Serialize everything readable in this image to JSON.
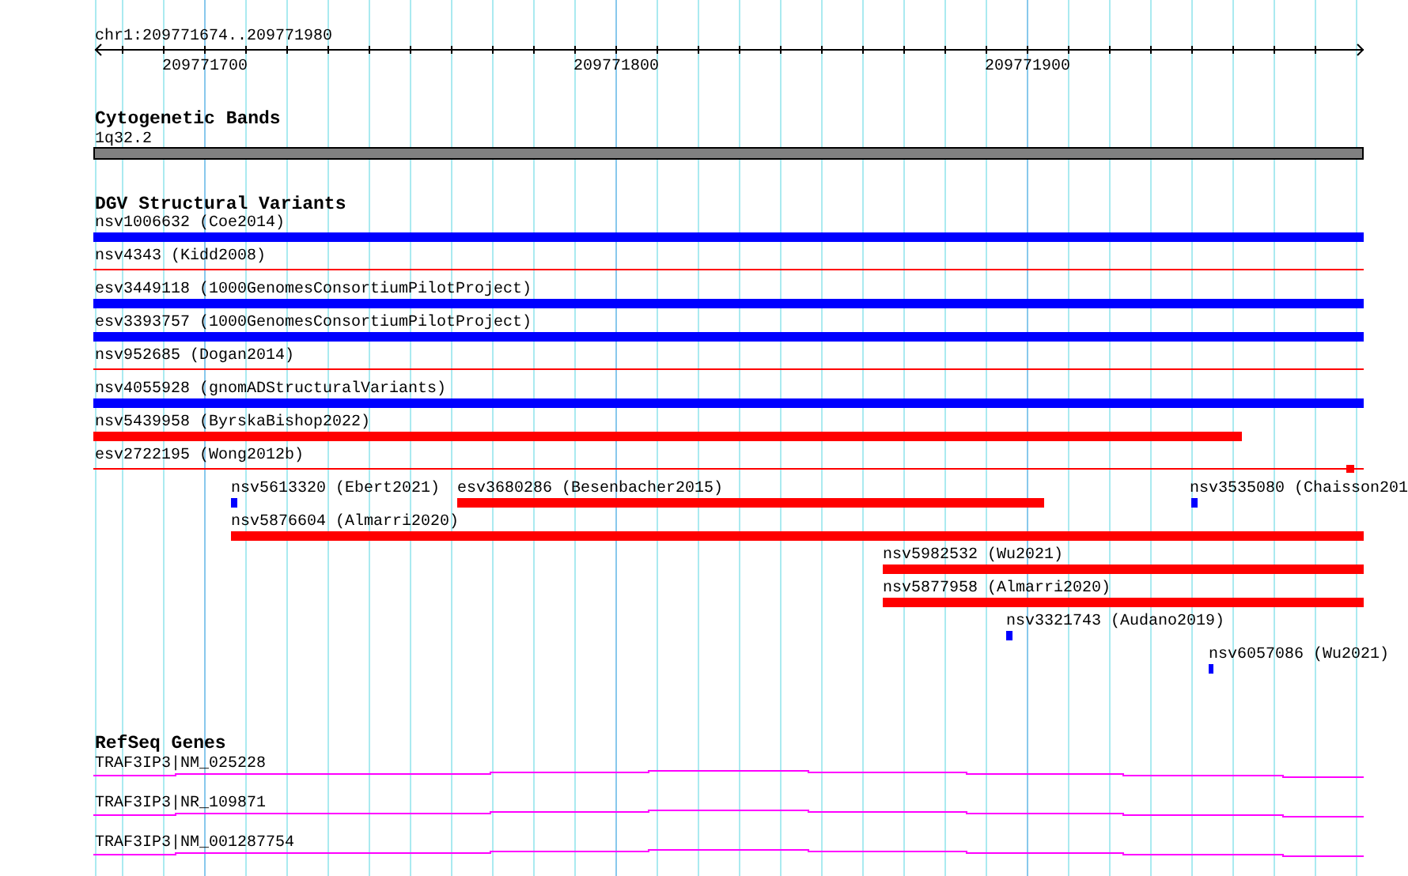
{
  "ruler": {
    "location": "chr1:209771674..209771980",
    "ticks": [
      "209771700",
      "209771800",
      "209771900"
    ]
  },
  "tracks": [
    {
      "kind": "bands",
      "title": "Cytogenetic Bands",
      "features": [
        {
          "label": "1q32.2"
        }
      ]
    },
    {
      "kind": "variants",
      "title": "DGV Structural Variants",
      "features": [
        {
          "label": "nsv1006632 (Coe2014)",
          "kind": "bar",
          "color": "#0000ff"
        },
        {
          "label": "nsv4343 (Kidd2008)",
          "kind": "line",
          "color": "#ff0000"
        },
        {
          "label": "esv3449118 (1000GenomesConsortiumPilotProject)",
          "kind": "bar",
          "color": "#0000ff"
        },
        {
          "label": "esv3393757 (1000GenomesConsortiumPilotProject)",
          "kind": "bar",
          "color": "#0000ff"
        },
        {
          "label": "nsv952685 (Dogan2014)",
          "kind": "line",
          "color": "#ff0000"
        },
        {
          "label": "nsv4055928 (gnomADStructuralVariants)",
          "kind": "bar",
          "color": "#0000ff"
        },
        {
          "label": "nsv5439958 (ByrskaBishop2022)",
          "kind": "bar",
          "color": "#ff0000"
        },
        {
          "label": "esv2722195 (Wong2012b)",
          "kind": "line-end",
          "color": "#ff0000"
        },
        {
          "label": "nsv5613320 (Ebert2021)",
          "kind": "bar",
          "color": "#0000ff"
        },
        {
          "label": "esv3680286 (Besenbacher2015)",
          "kind": "bar",
          "color": "#ff0000"
        },
        {
          "label": "nsv3535080 (Chaisson201",
          "kind": "bar",
          "color": "#0000ff"
        },
        {
          "label": "nsv5876604 (Almarri2020)",
          "kind": "bar",
          "color": "#ff0000"
        },
        {
          "label": "nsv5982532 (Wu2021)",
          "kind": "bar",
          "color": "#ff0000"
        },
        {
          "label": "nsv5877958 (Almarri2020)",
          "kind": "bar",
          "color": "#ff0000"
        },
        {
          "label": "nsv3321743 (Audano2019)",
          "kind": "bar",
          "color": "#0000ff"
        },
        {
          "label": "nsv6057086 (Wu2021)",
          "kind": "bar",
          "color": "#0000ff"
        }
      ]
    },
    {
      "kind": "genes",
      "title": "RefSeq Genes",
      "features": [
        {
          "label": "TRAF3IP3|NM_025228"
        },
        {
          "label": "TRAF3IP3|NR_109871"
        },
        {
          "label": "TRAF3IP3|NM_001287754"
        }
      ]
    }
  ]
}
